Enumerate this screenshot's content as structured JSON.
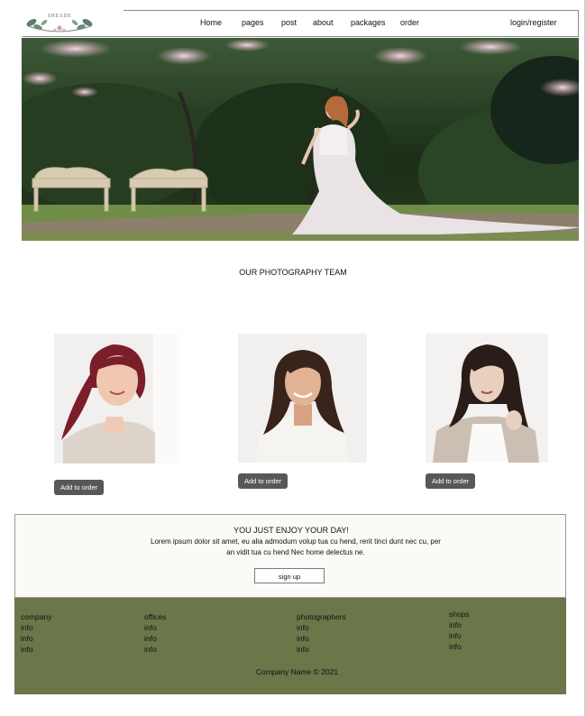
{
  "header": {
    "logo_text": "SHEADE",
    "nav": [
      "Home",
      "pages",
      "post",
      "about",
      "packages",
      "order"
    ],
    "login": "login/register"
  },
  "team": {
    "title": "OUR PHOTOGRAPHY TEAM",
    "order_label": "Add to order"
  },
  "cta": {
    "title": "YOU JUST ENJOY YOUR DAY!",
    "text": "Lorem ipsum dolor sit amet, eu alia admodum volup tua cu hend, rerit tinci dunt nec cu, per an vidit tua cu hend Nec home delectus ne.",
    "signup": "sign up"
  },
  "footer": {
    "columns": [
      {
        "title": "company",
        "items": [
          "info",
          "info",
          "info"
        ]
      },
      {
        "title": "offices",
        "items": [
          "info",
          "info",
          "info"
        ]
      },
      {
        "title": "photographers",
        "items": [
          "info",
          "info",
          "info"
        ]
      },
      {
        "title": "shops",
        "items": [
          "info",
          "info",
          "info"
        ]
      }
    ],
    "copyright": "Company Name © 2021"
  },
  "colors": {
    "footer_bg": "#6b7649",
    "button_bg": "#585858",
    "cta_bg": "#fcfaf7"
  }
}
